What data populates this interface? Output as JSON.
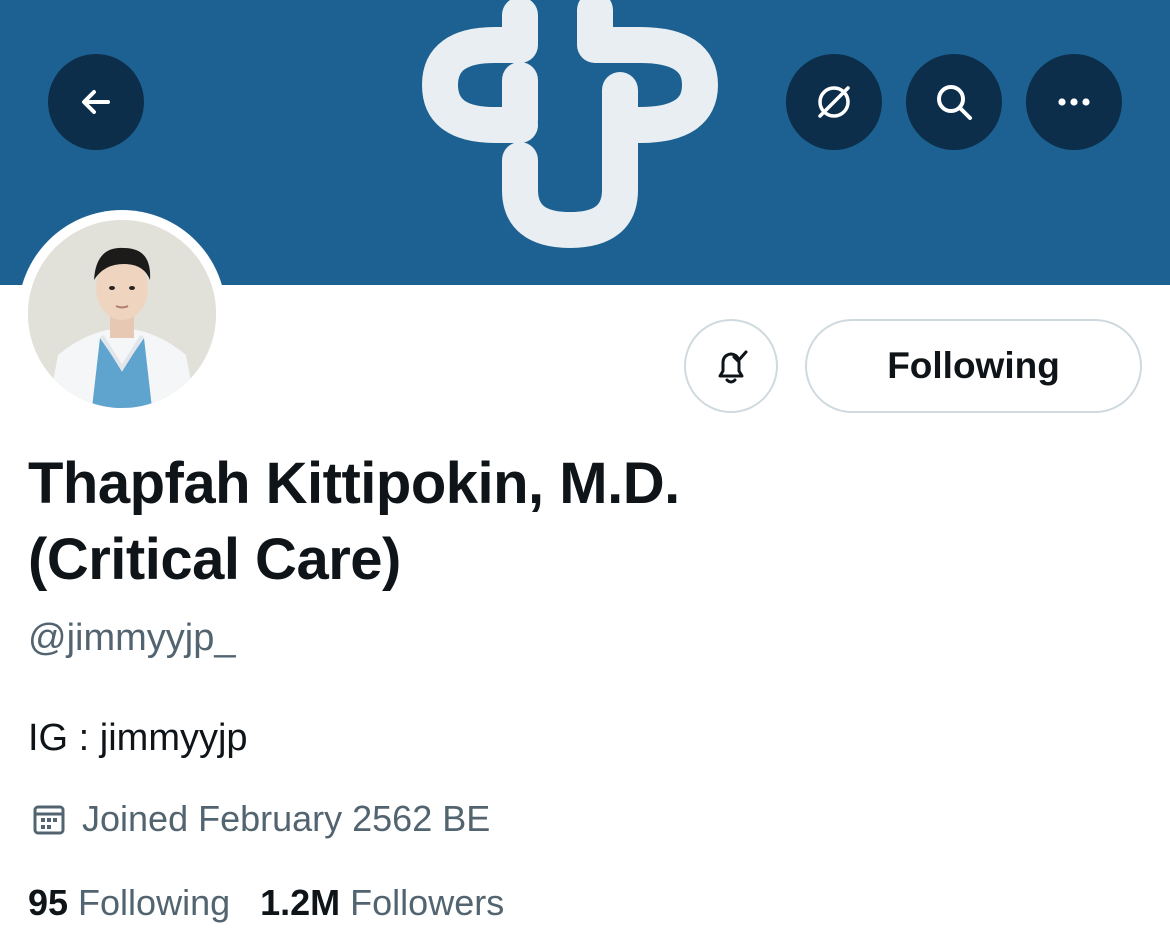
{
  "header": {
    "back_icon": "arrow-left-icon",
    "translate_icon": "globe-slash-icon",
    "search_icon": "search-icon",
    "more_icon": "more-horizontal-icon",
    "banner_color": "#1d6192"
  },
  "profile": {
    "display_name_line1": "Thapfah Kittipokin, M.D.",
    "display_name_line2": "(Critical Care)",
    "handle": "@jimmyyjp_",
    "bio": "IG : jimmyyjp",
    "joined": "Joined February 2562 BE",
    "following_count": "95",
    "following_label": "Following",
    "followers_count": "1.2M",
    "followers_label": "Followers"
  },
  "actions": {
    "notify_icon": "bell-check-icon",
    "following_button_label": "Following"
  }
}
